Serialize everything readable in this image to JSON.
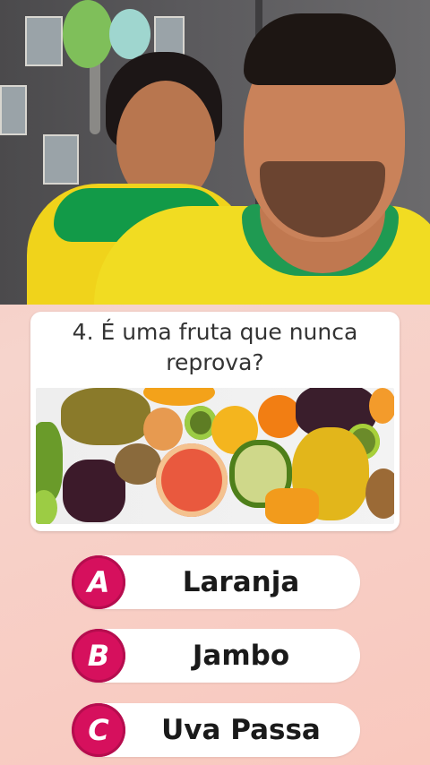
{
  "quiz": {
    "question": "4. É uma fruta que nunca reprova?",
    "options": [
      {
        "letter": "A",
        "label": "Laranja"
      },
      {
        "letter": "B",
        "label": "Jambo"
      },
      {
        "letter": "C",
        "label": "Uva Passa"
      }
    ]
  },
  "colors": {
    "badge": "#d6105d",
    "background": "#f8c9c1",
    "card": "#ffffff"
  }
}
